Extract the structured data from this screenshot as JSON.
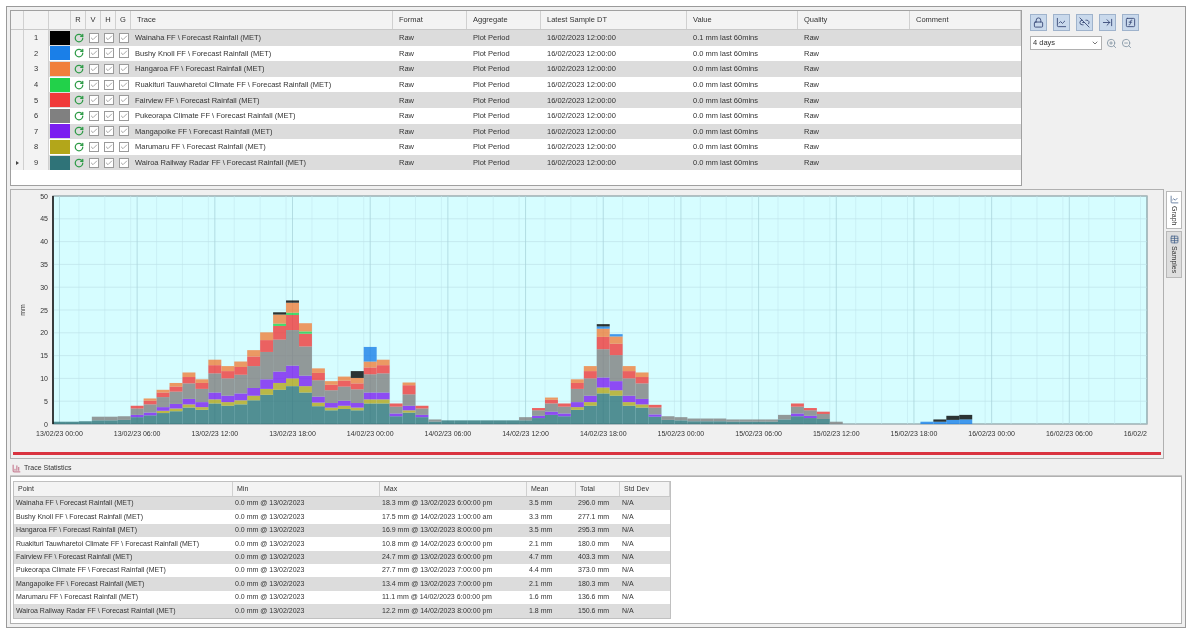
{
  "table": {
    "columns": [
      "R",
      "V",
      "H",
      "G",
      "Trace",
      "Format",
      "Aggregate",
      "Latest Sample DT",
      "Value",
      "Quality",
      "Comment"
    ],
    "rows": [
      {
        "number": "1",
        "selected": false,
        "color": "#000000",
        "v": true,
        "h": true,
        "g": true,
        "trace": "Wainaha FF \\ Forecast Rainfall (MET)",
        "format": "Raw",
        "aggregate": "Plot Period",
        "latest": "16/02/2023 12:00:00",
        "value": "0.1 mm last 60mins",
        "quality": "Raw"
      },
      {
        "number": "2",
        "selected": false,
        "color": "#1a7fe8",
        "v": true,
        "h": true,
        "g": true,
        "trace": "Bushy Knoll FF \\ Forecast Rainfall (MET)",
        "format": "Raw",
        "aggregate": "Plot Period",
        "latest": "16/02/2023 12:00:00",
        "value": "0.0 mm last 60mins",
        "quality": "Raw"
      },
      {
        "number": "3",
        "selected": false,
        "color": "#f07f3c",
        "v": true,
        "h": true,
        "g": true,
        "trace": "Hangaroa FF \\ Forecast Rainfall (MET)",
        "format": "Raw",
        "aggregate": "Plot Period",
        "latest": "16/02/2023 12:00:00",
        "value": "0.0 mm last 60mins",
        "quality": "Raw"
      },
      {
        "number": "4",
        "selected": false,
        "color": "#22d14a",
        "v": true,
        "h": true,
        "g": true,
        "trace": "Ruakituri Tauwharetoi Climate FF \\ Forecast Rainfall (MET)",
        "format": "Raw",
        "aggregate": "Plot Period",
        "latest": "16/02/2023 12:00:00",
        "value": "0.0 mm last 60mins",
        "quality": "Raw"
      },
      {
        "number": "5",
        "selected": false,
        "color": "#f03a3a",
        "v": true,
        "h": true,
        "g": true,
        "trace": "Fairview FF \\ Forecast Rainfall (MET)",
        "format": "Raw",
        "aggregate": "Plot Period",
        "latest": "16/02/2023 12:00:00",
        "value": "0.0 mm last 60mins",
        "quality": "Raw"
      },
      {
        "number": "6",
        "selected": false,
        "color": "#808080",
        "v": true,
        "h": true,
        "g": true,
        "trace": "Pukeorapa Climate FF \\ Forecast Rainfall (MET)",
        "format": "Raw",
        "aggregate": "Plot Period",
        "latest": "16/02/2023 12:00:00",
        "value": "0.0 mm last 60mins",
        "quality": "Raw"
      },
      {
        "number": "7",
        "selected": false,
        "color": "#7a1ef0",
        "v": true,
        "h": true,
        "g": true,
        "trace": "Mangapoike FF \\ Forecast Rainfall (MET)",
        "format": "Raw",
        "aggregate": "Plot Period",
        "latest": "16/02/2023 12:00:00",
        "value": "0.0 mm last 60mins",
        "quality": "Raw"
      },
      {
        "number": "8",
        "selected": false,
        "color": "#b3a61a",
        "v": true,
        "h": true,
        "g": true,
        "trace": "Marumaru FF \\ Forecast Rainfall (MET)",
        "format": "Raw",
        "aggregate": "Plot Period",
        "latest": "16/02/2023 12:00:00",
        "value": "0.0 mm last 60mins",
        "quality": "Raw"
      },
      {
        "number": "9",
        "selected": true,
        "color": "#2f7378",
        "v": true,
        "h": true,
        "g": true,
        "trace": "Wairoa Railway Radar FF \\ Forecast Rainfall (MET)",
        "format": "Raw",
        "aggregate": "Plot Period",
        "latest": "16/02/2023 12:00:00",
        "value": "0.0 mm last 60mins",
        "quality": "Raw"
      }
    ]
  },
  "toolbar": {
    "period": "4 days"
  },
  "chart": {
    "chart_data": {
      "type": "bar",
      "stacked": true,
      "grid": true,
      "ylabel": "mm",
      "ylim": [
        0,
        50
      ],
      "yticks": [
        0,
        5,
        10,
        15,
        20,
        25,
        30,
        35,
        40,
        45,
        50
      ],
      "categories": [
        "13/02/23 00:00",
        null,
        null,
        null,
        null,
        null,
        "13/02/23 06:00",
        null,
        null,
        null,
        null,
        null,
        "13/02/23 12:00",
        null,
        null,
        null,
        null,
        null,
        "13/02/23 18:00",
        null,
        null,
        null,
        null,
        null,
        "14/02/23 00:00",
        null,
        null,
        null,
        null,
        null,
        "14/02/23 06:00",
        null,
        null,
        null,
        null,
        null,
        "14/02/23 12:00",
        null,
        null,
        null,
        null,
        null,
        "14/02/23 18:00",
        null,
        null,
        null,
        null,
        null,
        "15/02/23 00:00",
        null,
        null,
        null,
        null,
        null,
        "15/02/23 06:00",
        null,
        null,
        null,
        null,
        null,
        "15/02/23 12:00",
        null,
        null,
        null,
        null,
        null,
        "15/02/23 18:00",
        null,
        null,
        null,
        null,
        null,
        "16/02/23 00:00",
        null,
        null,
        null,
        null,
        null,
        "16/02/23 06:00",
        null,
        null,
        null,
        null,
        null,
        "16/02/2"
      ],
      "series": [
        {
          "color": "#2f7378",
          "values": [
            0.5,
            0.5,
            0.6,
            0.8,
            0.8,
            0.9,
            1.5,
            1.9,
            2.4,
            2.8,
            3.6,
            3.1,
            4.5,
            4,
            4.3,
            5.2,
            6.4,
            7.5,
            8.3,
            6.9,
            3.9,
            3,
            3.3,
            3,
            4.5,
            4.5,
            1.7,
            2.5,
            1.5,
            0.5,
            0.8,
            0.8,
            0.8,
            0.8,
            0.8,
            0.8,
            0.8,
            1.3,
            2,
            1.7,
            3.1,
            4,
            6.7,
            6.2,
            4,
            3.6,
            1.6,
            0.9,
            0.8,
            0.6,
            0.6,
            0.6,
            0.5,
            0.5,
            0.5,
            0.5,
            1,
            1.7,
            1.3,
            1.1,
            0,
            0,
            0,
            0,
            0,
            0,
            0,
            0,
            0,
            0,
            0,
            0,
            0,
            0,
            0,
            0,
            0,
            0,
            0,
            0,
            0,
            0,
            0,
            0,
            0
          ]
        },
        {
          "color": "#b3a61a",
          "values": [
            0,
            0,
            0,
            0,
            0,
            0,
            0,
            0,
            0.5,
            0.6,
            0.7,
            0.6,
            0.9,
            0.8,
            0.9,
            1,
            1.3,
            1.5,
            1.7,
            1.4,
            0.8,
            0.6,
            0.7,
            0.6,
            0.9,
            0.9,
            0,
            0.5,
            0,
            0,
            0,
            0,
            0,
            0,
            0,
            0,
            0,
            0,
            0,
            0,
            0.6,
            0.8,
            1.3,
            1.2,
            0.8,
            0.7,
            0,
            0,
            0,
            0,
            0,
            0,
            0,
            0,
            0,
            0,
            0,
            0,
            0,
            0,
            0,
            0,
            0,
            0,
            0,
            0,
            0,
            0,
            0,
            0,
            0,
            0,
            0,
            0,
            0,
            0,
            0,
            0,
            0,
            0,
            0,
            0,
            0,
            0,
            0
          ]
        },
        {
          "color": "#7a1ef0",
          "values": [
            0,
            0,
            0,
            0,
            0,
            0,
            0.5,
            0.6,
            0.8,
            1,
            1.2,
            1.1,
            1.5,
            1.4,
            1.5,
            1.7,
            2.1,
            2.5,
            2.8,
            2.3,
            1.3,
            1,
            1.1,
            1,
            1.5,
            1.5,
            0.6,
            1,
            0.5,
            0,
            0,
            0,
            0,
            0,
            0,
            0,
            0,
            0.5,
            0.7,
            0.6,
            1.1,
            1.4,
            2.2,
            2,
            1.4,
            1.2,
            0.5,
            0,
            0,
            0,
            0,
            0,
            0,
            0,
            0,
            0,
            0,
            0.6,
            0.5,
            0,
            0,
            0,
            0,
            0,
            0,
            0,
            0,
            0,
            0,
            0,
            0,
            0,
            0,
            0,
            0,
            0,
            0,
            0,
            0,
            0,
            0,
            0,
            0,
            0,
            0
          ]
        },
        {
          "color": "#808080",
          "values": [
            0,
            0,
            0,
            0.8,
            0.8,
            0.8,
            1.4,
            1.8,
            2.2,
            2.7,
            3.4,
            2.9,
            4.2,
            3.8,
            4.1,
            4.8,
            6,
            7,
            7.8,
            6.4,
            3.6,
            2.8,
            3.1,
            3,
            4,
            4.2,
            1.5,
            2.5,
            1.4,
            0.5,
            0,
            0,
            0,
            0,
            0,
            0,
            0.7,
            1.2,
            1.8,
            1.5,
            2.9,
            3.8,
            6.2,
            5.7,
            3.8,
            3.4,
            1.5,
            0.8,
            0.7,
            0.6,
            0.6,
            0.6,
            0.5,
            0.5,
            0.5,
            0.5,
            1,
            1.5,
            1.2,
            1.1,
            0.5,
            0,
            0,
            0,
            0,
            0,
            0,
            0,
            0,
            0,
            0,
            0,
            0,
            0,
            0,
            0,
            0,
            0,
            0,
            0,
            0,
            0,
            0,
            0,
            0
          ]
        },
        {
          "color": "#f03a3a",
          "values": [
            0,
            0,
            0,
            0,
            0,
            0,
            0.6,
            0.8,
            1,
            1.1,
            1.4,
            1.3,
            1.8,
            1.6,
            1.7,
            2.1,
            2.6,
            3,
            3.3,
            2.8,
            1.6,
            1.2,
            1.3,
            1.3,
            1.5,
            1.8,
            0.7,
            2,
            0.6,
            0,
            0,
            0,
            0,
            0,
            0,
            0,
            0,
            0.5,
            0.8,
            0.7,
            1.3,
            1.6,
            2.7,
            2.5,
            1.6,
            1.4,
            0.6,
            0,
            0,
            0,
            0,
            0,
            0,
            0,
            0,
            0,
            0,
            0.7,
            0.5,
            0.5,
            0,
            0,
            0,
            0,
            0,
            0,
            0,
            0,
            0,
            0,
            0,
            0,
            0,
            0,
            0,
            0,
            0,
            0,
            0,
            0,
            0,
            0,
            0,
            0,
            0
          ]
        },
        {
          "color": "#22d14a",
          "values": [
            0,
            0,
            0,
            0,
            0,
            0,
            0,
            0,
            0,
            0,
            0,
            0,
            0,
            0,
            0,
            0,
            0,
            0.5,
            0.5,
            0.5,
            0,
            0,
            0,
            0,
            0,
            0,
            0,
            0,
            0,
            0,
            0,
            0,
            0,
            0,
            0,
            0,
            0,
            0,
            0,
            0,
            0,
            0,
            0,
            0,
            0,
            0,
            0,
            0,
            0,
            0,
            0,
            0,
            0,
            0,
            0,
            0,
            0,
            0,
            0,
            0,
            0,
            0,
            0,
            0,
            0,
            0,
            0,
            0,
            0,
            0,
            0,
            0,
            0,
            0,
            0,
            0,
            0,
            0,
            0,
            0,
            0,
            0,
            0,
            0,
            0
          ]
        },
        {
          "color": "#f07f3c",
          "values": [
            0,
            0,
            0,
            0,
            0,
            0,
            0,
            0.5,
            0.6,
            0.8,
            1,
            0.8,
            1.2,
            1.1,
            1.2,
            1.4,
            1.7,
            2,
            2.2,
            1.8,
            1,
            0.8,
            0.9,
            1.2,
            1.3,
            1.2,
            0,
            0.6,
            0,
            0,
            0,
            0,
            0,
            0,
            0,
            0,
            0,
            0,
            0.5,
            0,
            0.8,
            1.1,
            1.8,
            1.6,
            1.1,
            1,
            0,
            0,
            0,
            0,
            0,
            0,
            0,
            0,
            0,
            0,
            0,
            0,
            0,
            0,
            0,
            0,
            0,
            0,
            0,
            0,
            0,
            0,
            0,
            0,
            0,
            0,
            0,
            0,
            0,
            0,
            0,
            0,
            0,
            0,
            0,
            0,
            0,
            0,
            0
          ]
        },
        {
          "color": "#1a7fe8",
          "values": [
            0,
            0,
            0,
            0,
            0,
            0,
            0,
            0,
            0,
            0,
            0,
            0,
            0,
            0,
            0,
            0,
            0,
            0,
            0,
            0,
            0,
            0,
            0,
            0,
            3.2,
            0,
            0,
            0,
            0,
            0,
            0,
            0,
            0,
            0,
            0,
            0,
            0,
            0,
            0,
            0,
            0,
            0,
            0.5,
            0.5,
            0,
            0,
            0,
            0,
            0,
            0,
            0,
            0,
            0,
            0,
            0,
            0,
            0,
            0,
            0,
            0,
            0,
            0,
            0,
            0,
            0,
            0,
            0,
            0.5,
            0.5,
            0.9,
            1,
            0,
            0,
            0,
            0,
            0,
            0,
            0,
            0,
            0,
            0,
            0,
            0,
            0,
            0
          ]
        },
        {
          "color": "#000000",
          "values": [
            0,
            0,
            0,
            0,
            0,
            0,
            0,
            0,
            0,
            0,
            0,
            0,
            0,
            0,
            0,
            0,
            0,
            0.5,
            0.5,
            0,
            0,
            0,
            0,
            1.5,
            0,
            0,
            0,
            0,
            0,
            0,
            0,
            0,
            0,
            0,
            0,
            0,
            0,
            0,
            0,
            0,
            0,
            0,
            0.5,
            0,
            0,
            0,
            0,
            0,
            0,
            0,
            0,
            0,
            0,
            0,
            0,
            0,
            0,
            0,
            0,
            0,
            0,
            0,
            0,
            0,
            0,
            0,
            0,
            0,
            0.5,
            0.9,
            1,
            0,
            0,
            0,
            0,
            0,
            0,
            0,
            0,
            0,
            0,
            0,
            0,
            0,
            0
          ]
        }
      ]
    }
  },
  "side_tabs": [
    {
      "label": "Graph",
      "selected": true
    },
    {
      "label": "Samples",
      "selected": false
    }
  ],
  "statistics": {
    "title": "Trace Statistics",
    "columns": [
      "Point",
      "Min",
      "Max",
      "Mean",
      "Total",
      "Std Dev"
    ],
    "rows": [
      [
        "Wainaha FF \\ Forecast Rainfall (MET)",
        "0.0 mm @ 13/02/2023",
        "18.3 mm @ 13/02/2023 6:00:00 pm",
        "3.5 mm",
        "296.0 mm",
        "N/A"
      ],
      [
        "Bushy Knoll FF \\ Forecast Rainfall (MET)",
        "0.0 mm @ 13/02/2023",
        "17.5 mm @ 14/02/2023 1:00:00 am",
        "3.3 mm",
        "277.1 mm",
        "N/A"
      ],
      [
        "Hangaroa FF \\ Forecast Rainfall (MET)",
        "0.0 mm @ 13/02/2023",
        "16.9 mm @ 13/02/2023 8:00:00 pm",
        "3.5 mm",
        "295.3 mm",
        "N/A"
      ],
      [
        "Ruakituri Tauwharetoi Climate FF \\ Forecast Rainfall (MET)",
        "0.0 mm @ 13/02/2023",
        "10.8 mm @ 14/02/2023 6:00:00 pm",
        "2.1 mm",
        "180.0 mm",
        "N/A"
      ],
      [
        "Fairview FF \\ Forecast Rainfall (MET)",
        "0.0 mm @ 13/02/2023",
        "24.7 mm @ 13/02/2023 6:00:00 pm",
        "4.7 mm",
        "403.3 mm",
        "N/A"
      ],
      [
        "Pukeorapa Climate FF \\ Forecast Rainfall (MET)",
        "0.0 mm @ 13/02/2023",
        "27.7 mm @ 13/02/2023 7:00:00 pm",
        "4.4 mm",
        "373.0 mm",
        "N/A"
      ],
      [
        "Mangapoike FF \\ Forecast Rainfall (MET)",
        "0.0 mm @ 13/02/2023",
        "13.4 mm @ 13/02/2023 7:00:00 pm",
        "2.1 mm",
        "180.3 mm",
        "N/A"
      ],
      [
        "Marumaru FF \\ Forecast Rainfall (MET)",
        "0.0 mm @ 13/02/2023",
        "11.1 mm @ 14/02/2023 6:00:00 pm",
        "1.6 mm",
        "136.6 mm",
        "N/A"
      ],
      [
        "Wairoa Railway Radar FF \\ Forecast Rainfall (MET)",
        "0.0 mm @ 13/02/2023",
        "12.2 mm @ 14/02/2023 8:00:00 pm",
        "1.8 mm",
        "150.6 mm",
        "N/A"
      ]
    ]
  }
}
